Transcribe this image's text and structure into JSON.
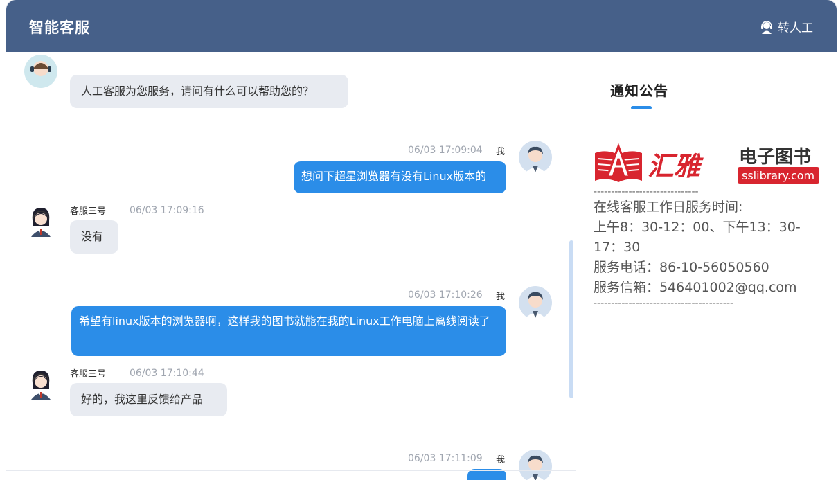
{
  "header": {
    "title": "智能客服",
    "transfer_label": "转人工"
  },
  "messages": [
    {
      "side": "agent",
      "text": "人工客服为您服务，请问有什么可以帮助您的？"
    },
    {
      "side": "user",
      "name": "我",
      "time": "06/03 17:09:04",
      "text": "想问下超星浏览器有没有Linux版本的"
    },
    {
      "side": "agent",
      "name": "客服三号",
      "time": "06/03 17:09:16",
      "text": "没有"
    },
    {
      "side": "user",
      "name": "我",
      "time": "06/03 17:10:26",
      "text": "希望有linux版本的浏览器啊，这样我的图书就能在我的Linux工作电脑上离线阅读了"
    },
    {
      "side": "agent",
      "name": "客服三号",
      "time": "06/03 17:10:44",
      "text": "好的，我这里反馈给产品"
    },
    {
      "side": "user",
      "name": "我",
      "time": "06/03 17:11:09",
      "text": ""
    }
  ],
  "notice": {
    "title": "通知公告",
    "logo_brand": "汇雅",
    "logo_tagline": "电子图书",
    "logo_url": "sslibrary.com",
    "divider_top": "------------------------------",
    "lines": [
      "在线客服工作日服务时间:",
      "上午8：30-12：00、下午13：30-17：30",
      "服务电话：86-10-56050560",
      "服务信箱：546401002@qq.com"
    ],
    "divider_bottom": "----------------------------------------"
  },
  "colors": {
    "header": "#466089",
    "accent": "#2b8de8",
    "agent_bubble": "#e8ebf1",
    "logo_red": "#d8252f"
  }
}
